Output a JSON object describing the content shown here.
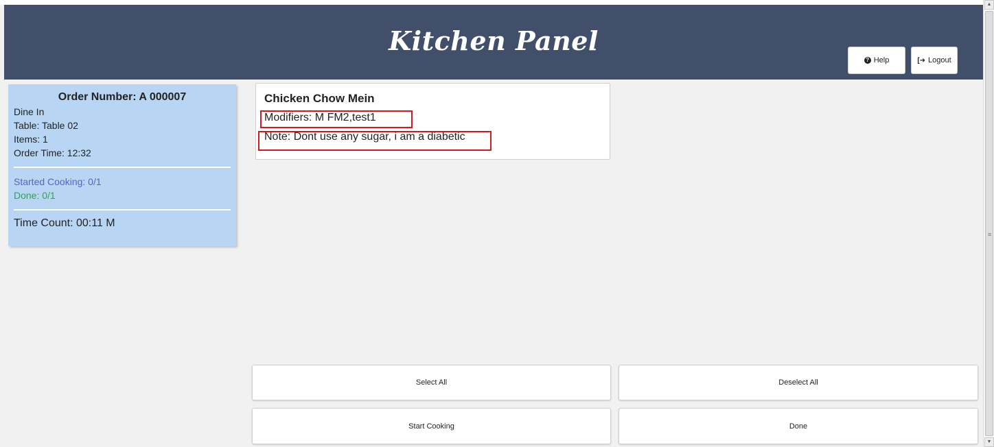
{
  "header": {
    "title": "Kitchen Panel",
    "help_label": "Help",
    "logout_label": "Logout"
  },
  "order": {
    "number": "Order Number: A 000007",
    "type": "Dine In",
    "table": "Table: Table 02",
    "items": "Items: 1",
    "order_time": "Order Time: 12:32",
    "started_cooking": "Started Cooking: 0/1",
    "done": "Done: 0/1",
    "time_count": "Time Count: 00:11 M"
  },
  "item": {
    "name": "Chicken Chow Mein",
    "modifiers": "Modifiers: M FM2,test1",
    "note": "Note: Dont use any sugar, i am a diabetic"
  },
  "actions": {
    "select_all": "Select All",
    "deselect_all": "Deselect All",
    "start_cooking": "Start Cooking",
    "done": "Done"
  },
  "icons": {
    "help": "question-circle-icon",
    "logout": "sign-out-icon"
  },
  "colors": {
    "header_bg": "#414f6a",
    "order_card_bg": "#b8d6f3",
    "started_text": "#5b60c8",
    "done_text": "#2aa64a",
    "highlight_border": "#d11a1a"
  }
}
